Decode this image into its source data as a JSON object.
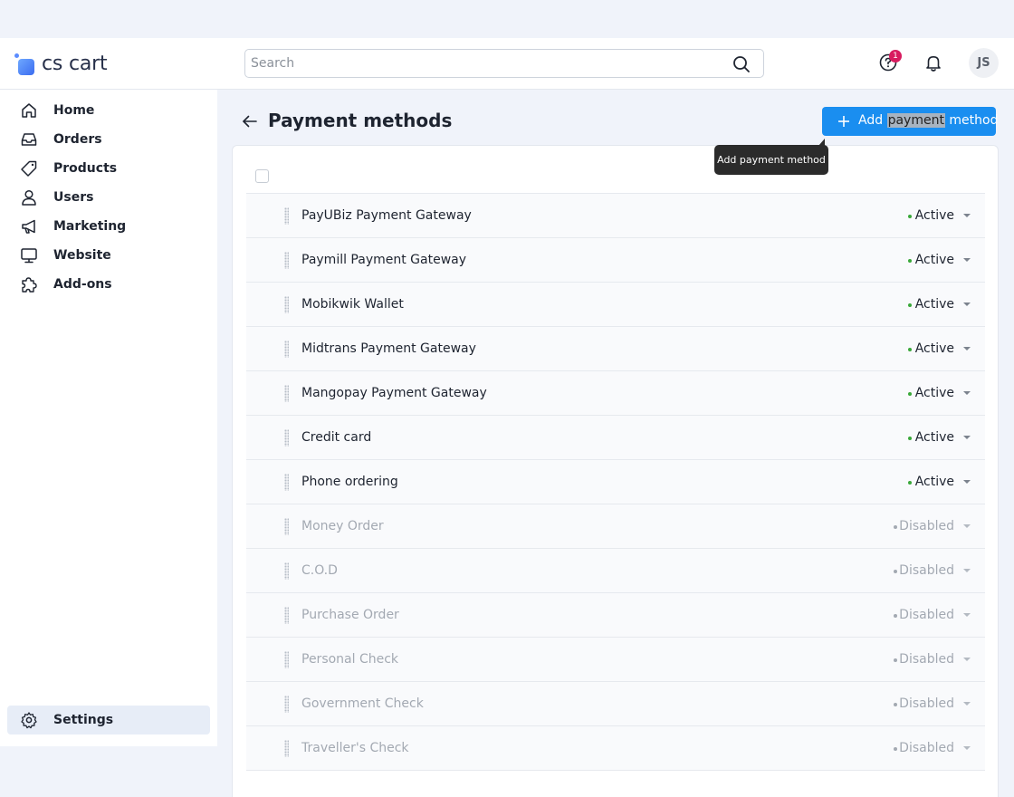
{
  "app": {
    "logo_text": "cs cart"
  },
  "header": {
    "search_placeholder": "Search",
    "help_badge": "1",
    "avatar_initials": "JS"
  },
  "sidebar": {
    "items": [
      {
        "label": "Home",
        "icon": "home-icon"
      },
      {
        "label": "Orders",
        "icon": "inbox-icon"
      },
      {
        "label": "Products",
        "icon": "tag-icon"
      },
      {
        "label": "Users",
        "icon": "user-icon"
      },
      {
        "label": "Marketing",
        "icon": "megaphone-icon"
      },
      {
        "label": "Website",
        "icon": "monitor-icon"
      },
      {
        "label": "Add-ons",
        "icon": "puzzle-icon"
      }
    ],
    "settings": {
      "label": "Settings",
      "icon": "gear-icon"
    }
  },
  "page": {
    "title": "Payment methods",
    "add_button": {
      "pre": "Add ",
      "highlighted": "payment",
      "post": " method"
    },
    "tooltip": "Add payment method"
  },
  "colors": {
    "accent": "#1a8ef0",
    "active_dot": "#3aa83a",
    "badge": "#d81b5f"
  },
  "methods": [
    {
      "name": "PayUBiz Payment Gateway",
      "status": "Active"
    },
    {
      "name": "Paymill Payment Gateway",
      "status": "Active"
    },
    {
      "name": "Mobikwik Wallet",
      "status": "Active"
    },
    {
      "name": "Midtrans Payment Gateway",
      "status": "Active"
    },
    {
      "name": "Mangopay Payment Gateway",
      "status": "Active"
    },
    {
      "name": "Credit card",
      "status": "Active"
    },
    {
      "name": "Phone ordering",
      "status": "Active"
    },
    {
      "name": "Money Order",
      "status": "Disabled"
    },
    {
      "name": "C.O.D",
      "status": "Disabled"
    },
    {
      "name": "Purchase Order",
      "status": "Disabled"
    },
    {
      "name": "Personal Check",
      "status": "Disabled"
    },
    {
      "name": "Government Check",
      "status": "Disabled"
    },
    {
      "name": "Traveller's Check",
      "status": "Disabled"
    }
  ]
}
